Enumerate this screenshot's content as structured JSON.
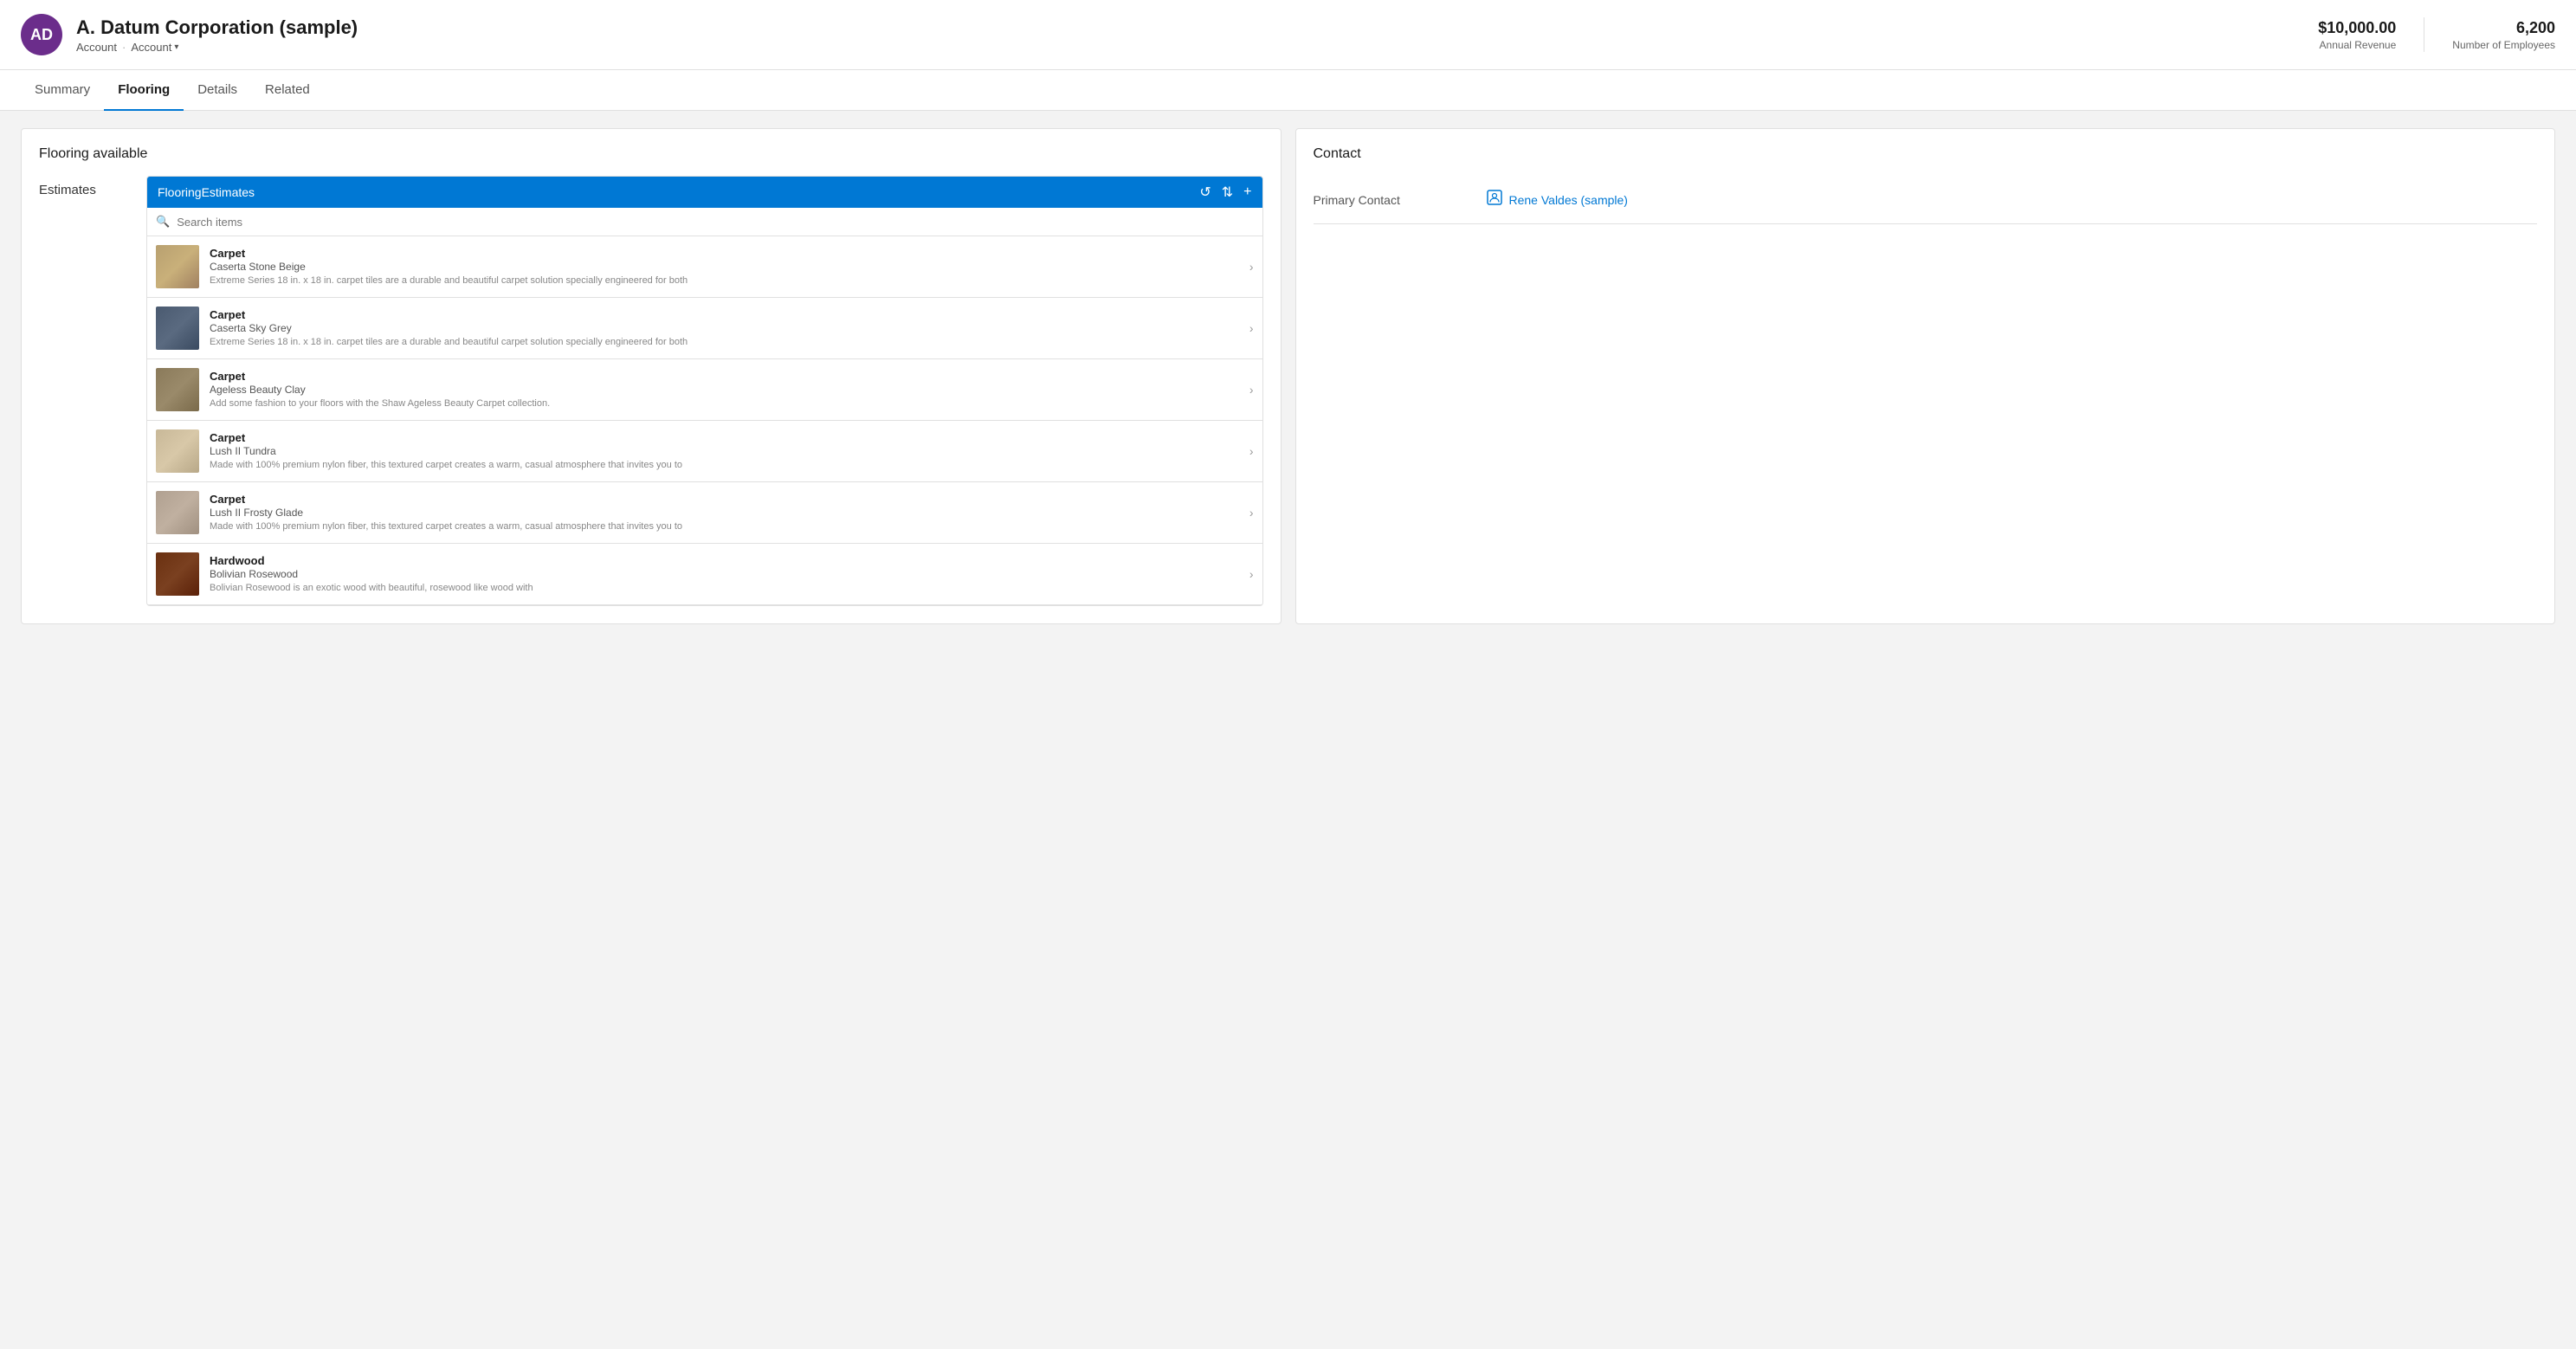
{
  "header": {
    "avatar_initials": "AD",
    "avatar_bg": "#6b2d8b",
    "company_name": "A. Datum Corporation (sample)",
    "breadcrumb_first": "Account",
    "breadcrumb_second": "Account",
    "annual_revenue_label": "Annual Revenue",
    "annual_revenue_value": "$10,000.00",
    "employees_label": "Number of Employees",
    "employees_value": "6,200"
  },
  "nav": {
    "tabs": [
      {
        "id": "summary",
        "label": "Summary",
        "active": false
      },
      {
        "id": "flooring",
        "label": "Flooring",
        "active": true
      },
      {
        "id": "details",
        "label": "Details",
        "active": false
      },
      {
        "id": "related",
        "label": "Related",
        "active": false
      }
    ]
  },
  "flooring_section": {
    "card_title": "Flooring available",
    "label": "Estimates",
    "widget": {
      "title": "FlooringEstimates",
      "refresh_icon": "↺",
      "sort_icon": "⇅",
      "add_icon": "+",
      "search_placeholder": "Search items"
    },
    "items": [
      {
        "type": "Carpet",
        "name": "Caserta Stone Beige",
        "description": "Extreme Series 18 in. x 18 in. carpet tiles are a durable and beautiful carpet solution specially engineered for both",
        "swatch_class": "swatch-stone-beige"
      },
      {
        "type": "Carpet",
        "name": "Caserta Sky Grey",
        "description": "Extreme Series 18 in. x 18 in. carpet tiles are a durable and beautiful carpet solution specially engineered for both",
        "swatch_class": "swatch-sky-grey"
      },
      {
        "type": "Carpet",
        "name": "Ageless Beauty Clay",
        "description": "Add some fashion to your floors with the Shaw Ageless Beauty Carpet collection.",
        "swatch_class": "swatch-beauty-clay"
      },
      {
        "type": "Carpet",
        "name": "Lush II Tundra",
        "description": "Made with 100% premium nylon fiber, this textured carpet creates a warm, casual atmosphere that invites you to",
        "swatch_class": "swatch-lush-tundra"
      },
      {
        "type": "Carpet",
        "name": "Lush II Frosty Glade",
        "description": "Made with 100% premium nylon fiber, this textured carpet creates a warm, casual atmosphere that invites you to",
        "swatch_class": "swatch-frosty-glade"
      },
      {
        "type": "Hardwood",
        "name": "Bolivian Rosewood",
        "description": "Bolivian Rosewood is an exotic wood with beautiful, rosewood like wood with",
        "swatch_class": "swatch-bolivian-rosewood"
      }
    ]
  },
  "contact_section": {
    "card_title": "Contact",
    "primary_contact_label": "Primary Contact",
    "primary_contact_name": "Rene Valdes (sample)",
    "contact_icon": "👤"
  }
}
